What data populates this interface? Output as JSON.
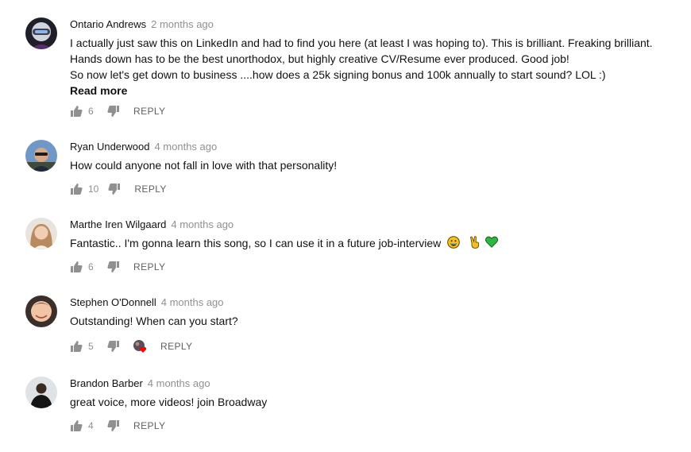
{
  "comments": [
    {
      "author": "Ontario Andrews",
      "time": "2 months ago",
      "lines": [
        "I actually just saw this on LinkedIn and had to find you here (at least I was hoping to).  This is brilliant. Freaking brilliant.",
        "Hands down has to be the best unorthodox, but highly creative CV/Resume ever produced. Good job!",
        "So now let's get down to business ....how does a 25k signing bonus and 100k annually to start sound?  LOL :)"
      ],
      "read_more": "Read more",
      "likes": "6",
      "reply": "REPLY"
    },
    {
      "author": "Ryan Underwood",
      "time": "4 months ago",
      "lines": [
        "How could anyone not fall in love with that personality!"
      ],
      "likes": "10",
      "reply": "REPLY"
    },
    {
      "author": "Marthe Iren Wilgaard",
      "time": "4 months ago",
      "lines": [
        "Fantastic.. I'm gonna learn this song, so I can use it in a future job-interview"
      ],
      "emojis": [
        "grinning-face",
        "victory-hand",
        "green-heart"
      ],
      "likes": "6",
      "reply": "REPLY"
    },
    {
      "author": "Stephen O'Donnell",
      "time": "4 months ago",
      "lines": [
        "Outstanding! When can you start?"
      ],
      "likes": "5",
      "creator_heart": true,
      "reply": "REPLY"
    },
    {
      "author": "Brandon Barber",
      "time": "4 months ago",
      "lines": [
        "great voice, more videos! join Broadway"
      ],
      "likes": "4",
      "reply": "REPLY"
    }
  ],
  "icons": {
    "like": "thumbs-up-icon",
    "dislike": "thumbs-down-icon",
    "heart": "creator-heart-icon"
  },
  "colors": {
    "icon_gray": "#909090",
    "heart_red": "#ff0000",
    "green_heart": "#2db742"
  }
}
